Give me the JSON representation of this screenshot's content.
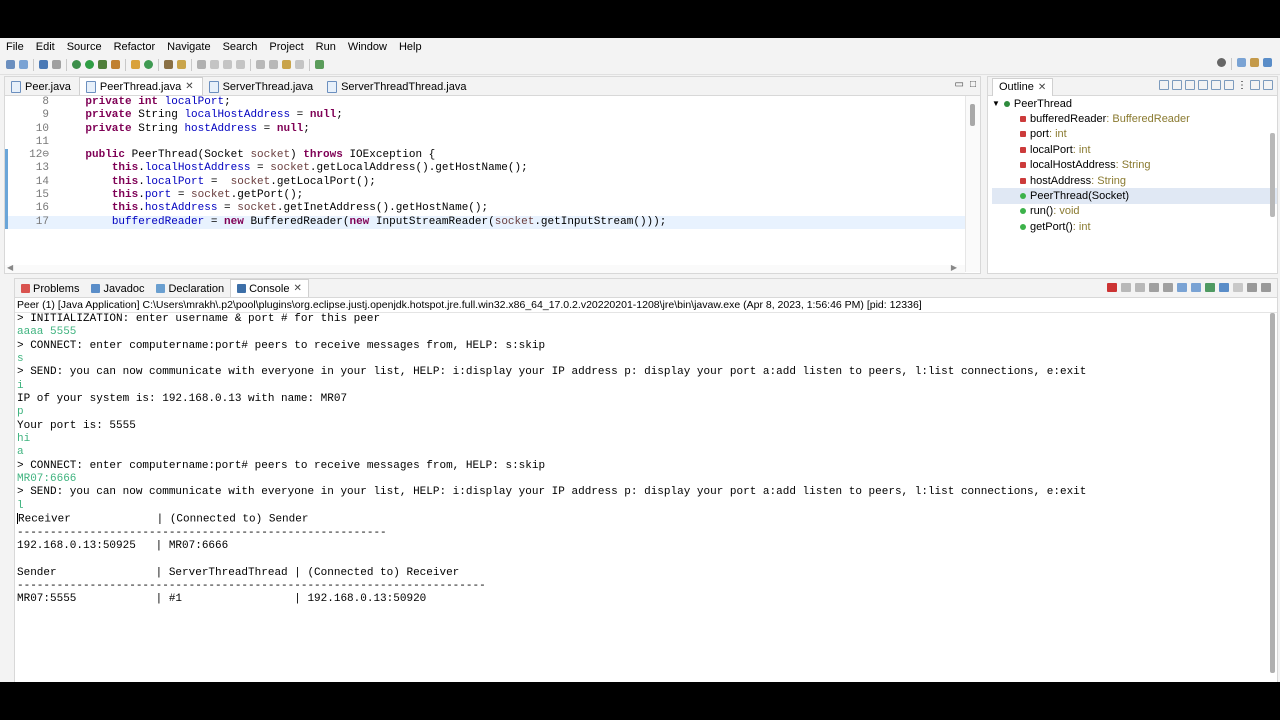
{
  "menu": [
    "File",
    "Edit",
    "Source",
    "Refactor",
    "Navigate",
    "Search",
    "Project",
    "Run",
    "Window",
    "Help"
  ],
  "editor": {
    "tabs": [
      {
        "label": "Peer.java",
        "active": false
      },
      {
        "label": "PeerThread.java",
        "active": true
      },
      {
        "label": "ServerThread.java",
        "active": false
      },
      {
        "label": "ServerThreadThread.java",
        "active": false
      }
    ],
    "lines": [
      {
        "n": "8",
        "tokens": [
          {
            "t": "    "
          },
          {
            "t": "private",
            "c": "kw"
          },
          {
            "t": " "
          },
          {
            "t": "int",
            "c": "kw"
          },
          {
            "t": " "
          },
          {
            "t": "localPort",
            "c": "fld"
          },
          {
            "t": ";"
          }
        ]
      },
      {
        "n": "9",
        "tokens": [
          {
            "t": "    "
          },
          {
            "t": "private",
            "c": "kw"
          },
          {
            "t": " String "
          },
          {
            "t": "localHostAddress",
            "c": "fld"
          },
          {
            "t": " = "
          },
          {
            "t": "null",
            "c": "kw"
          },
          {
            "t": ";"
          }
        ]
      },
      {
        "n": "10",
        "tokens": [
          {
            "t": "    "
          },
          {
            "t": "private",
            "c": "kw"
          },
          {
            "t": " String "
          },
          {
            "t": "hostAddress",
            "c": "fld"
          },
          {
            "t": " = "
          },
          {
            "t": "null",
            "c": "kw"
          },
          {
            "t": ";"
          }
        ]
      },
      {
        "n": "11",
        "tokens": [
          {
            "t": ""
          }
        ]
      },
      {
        "n": "12⊖",
        "mark": true,
        "tokens": [
          {
            "t": "    "
          },
          {
            "t": "public",
            "c": "kw"
          },
          {
            "t": " PeerThread(Socket "
          },
          {
            "t": "socket",
            "c": "par"
          },
          {
            "t": ") "
          },
          {
            "t": "throws",
            "c": "kw"
          },
          {
            "t": " IOException {"
          }
        ]
      },
      {
        "n": "13",
        "mark": true,
        "tokens": [
          {
            "t": "        "
          },
          {
            "t": "this",
            "c": "kw"
          },
          {
            "t": "."
          },
          {
            "t": "localHostAddress",
            "c": "fld"
          },
          {
            "t": " = "
          },
          {
            "t": "socket",
            "c": "par"
          },
          {
            "t": ".getLocalAddress().getHostName();"
          }
        ]
      },
      {
        "n": "14",
        "mark": true,
        "tokens": [
          {
            "t": "        "
          },
          {
            "t": "this",
            "c": "kw"
          },
          {
            "t": "."
          },
          {
            "t": "localPort",
            "c": "fld"
          },
          {
            "t": " =  "
          },
          {
            "t": "socket",
            "c": "par"
          },
          {
            "t": ".getLocalPort();"
          }
        ]
      },
      {
        "n": "15",
        "mark": true,
        "tokens": [
          {
            "t": "        "
          },
          {
            "t": "this",
            "c": "kw"
          },
          {
            "t": "."
          },
          {
            "t": "port",
            "c": "fld"
          },
          {
            "t": " = "
          },
          {
            "t": "socket",
            "c": "par"
          },
          {
            "t": ".getPort();"
          }
        ]
      },
      {
        "n": "16",
        "mark": true,
        "tokens": [
          {
            "t": "        "
          },
          {
            "t": "this",
            "c": "kw"
          },
          {
            "t": "."
          },
          {
            "t": "hostAddress",
            "c": "fld"
          },
          {
            "t": " = "
          },
          {
            "t": "socket",
            "c": "par"
          },
          {
            "t": ".getInetAddress().getHostName();"
          }
        ]
      },
      {
        "n": "17",
        "mark": true,
        "cur": true,
        "tokens": [
          {
            "t": "        "
          },
          {
            "t": "bufferedReader",
            "c": "fld"
          },
          {
            "t": " = "
          },
          {
            "t": "new",
            "c": "kw"
          },
          {
            "t": " BufferedReader("
          },
          {
            "t": "new",
            "c": "kw"
          },
          {
            "t": " InputStreamReader("
          },
          {
            "t": "socket",
            "c": "par"
          },
          {
            "t": ".getInputStream()));"
          }
        ]
      }
    ]
  },
  "outline": {
    "title": "Outline",
    "root": "PeerThread",
    "items": [
      {
        "name": "bufferedReader",
        "type": " : BufferedReader",
        "icon": "private-field-icon"
      },
      {
        "name": "port",
        "type": " : int",
        "icon": "private-field-icon"
      },
      {
        "name": "localPort",
        "type": " : int",
        "icon": "private-field-icon"
      },
      {
        "name": "localHostAddress",
        "type": " : String",
        "icon": "private-field-icon"
      },
      {
        "name": "hostAddress",
        "type": " : String",
        "icon": "private-field-icon"
      },
      {
        "name": "PeerThread(Socket)",
        "type": "",
        "icon": "constructor-icon",
        "selected": true
      },
      {
        "name": "run()",
        "type": " : void",
        "icon": "public-method-icon"
      },
      {
        "name": "getPort()",
        "type": " : int",
        "icon": "public-method-icon"
      }
    ]
  },
  "console": {
    "tabs": [
      {
        "label": "Problems",
        "icon": "problems-icon",
        "color": "#d9534f",
        "active": false
      },
      {
        "label": "Javadoc",
        "icon": "javadoc-icon",
        "color": "#5a8dc8",
        "active": false
      },
      {
        "label": "Declaration",
        "icon": "declaration-icon",
        "color": "#6a9fd0",
        "active": false
      },
      {
        "label": "Console",
        "icon": "console-icon",
        "color": "#3d6fa8",
        "active": true
      }
    ],
    "header": "Peer (1) [Java Application] C:\\Users\\mrakh\\.p2\\pool\\plugins\\org.eclipse.justj.openjdk.hotspot.jre.full.win32.x86_64_17.0.2.v20220201-1208\\jre\\bin\\javaw.exe  (Apr 8, 2023, 1:56:46 PM) [pid: 12336]",
    "lines": [
      {
        "t": "> INITIALIZATION: enter username & port # for this peer"
      },
      {
        "t": "aaaa 5555",
        "in": true
      },
      {
        "t": "> CONNECT: enter computername:port# peers to receive messages from, HELP: s:skip"
      },
      {
        "t": "s",
        "in": true
      },
      {
        "t": "> SEND: you can now communicate with everyone in your list, HELP: i:display your IP address p: display your port a:add listen to peers, l:list connections, e:exit"
      },
      {
        "t": "i",
        "in": true
      },
      {
        "t": "IP of your system is: 192.168.0.13 with name: MR07"
      },
      {
        "t": "p",
        "in": true
      },
      {
        "t": "Your port is: 5555"
      },
      {
        "t": "hi",
        "in": true
      },
      {
        "t": "a",
        "in": true
      },
      {
        "t": "> CONNECT: enter computername:port# peers to receive messages from, HELP: s:skip"
      },
      {
        "t": "MR07:6666",
        "in": true
      },
      {
        "t": "> SEND: you can now communicate with everyone in your list, HELP: i:display your IP address p: display your port a:add listen to peers, l:list connections, e:exit"
      },
      {
        "t": "l",
        "in": true
      },
      {
        "t": "Receiver             | (Connected to) Sender",
        "caret": true
      },
      {
        "t": "--------------------------------------------------------"
      },
      {
        "t": "192.168.0.13:50925   | MR07:6666"
      },
      {
        "t": ""
      },
      {
        "t": "Sender               | ServerThreadThread | (Connected to) Receiver"
      },
      {
        "t": "-----------------------------------------------------------------------"
      },
      {
        "t": "MR07:5555            | #1                 | 192.168.0.13:50920"
      }
    ]
  },
  "colors": {
    "keyword": "#7f0055",
    "field": "#0000c0",
    "input": "#3fb37f",
    "background": "#f3f3f3"
  }
}
